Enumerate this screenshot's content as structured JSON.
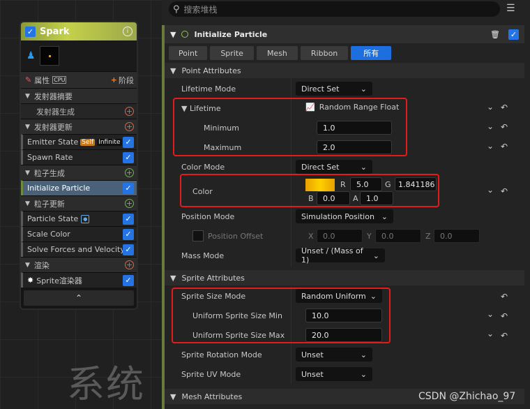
{
  "emitter": {
    "title": "Spark",
    "cpu_label": "属性",
    "cpu_badge": "CPU",
    "stage_button": "阶段",
    "rows": [
      {
        "label": "发射器摘要",
        "kind": "sec"
      },
      {
        "label": "发射器生成",
        "kind": "sub",
        "action": "add"
      },
      {
        "label": "发射器更新",
        "kind": "sec",
        "action": "add"
      },
      {
        "label": "Emitter State",
        "kind": "itm",
        "tag1": "Self",
        "tag2": "Infinite",
        "check": true
      },
      {
        "label": "Spawn Rate",
        "kind": "itm",
        "check": true
      },
      {
        "label": "粒子生成",
        "kind": "sec",
        "action": "add-green"
      },
      {
        "label": "Initialize Particle",
        "kind": "sel",
        "check": true
      },
      {
        "label": "粒子更新",
        "kind": "sec",
        "action": "add-green"
      },
      {
        "label": "Particle State",
        "kind": "itm",
        "dot": true,
        "check": true
      },
      {
        "label": "Scale Color",
        "kind": "itm",
        "check": true
      },
      {
        "label": "Solve Forces and Velocity",
        "kind": "itm",
        "check": true
      },
      {
        "label": "渲染",
        "kind": "sec",
        "action": "add"
      },
      {
        "label": "Sprite渲染器",
        "kind": "itm",
        "star": true,
        "check": true
      }
    ]
  },
  "watermark": "系统",
  "credit": "CSDN @Zhichao_97",
  "search": {
    "placeholder": "搜索堆栈"
  },
  "module": {
    "title": "Initialize Particle",
    "tabs": [
      "Point",
      "Sprite",
      "Mesh",
      "Ribbon",
      "所有"
    ],
    "active_tab": "所有"
  },
  "sections": {
    "point": "Point Attributes",
    "sprite": "Sprite Attributes",
    "mesh": "Mesh Attributes"
  },
  "props": {
    "lifetime_mode": {
      "label": "Lifetime Mode",
      "value": "Direct Set"
    },
    "lifetime": {
      "label": "Lifetime",
      "value": "Random Range Float"
    },
    "minimum": {
      "label": "Minimum",
      "value": "1.0"
    },
    "maximum": {
      "label": "Maximum",
      "value": "2.0"
    },
    "color_mode": {
      "label": "Color Mode",
      "value": "Direct Set"
    },
    "color": {
      "label": "Color",
      "r": "5.0",
      "g": "1.841186",
      "b": "0.0",
      "a": "1.0",
      "swatch": "#f2b800"
    },
    "position_mode": {
      "label": "Position Mode",
      "value": "Simulation Position"
    },
    "position_offset": {
      "label": "Position Offset",
      "x": "0.0",
      "y": "0.0",
      "z": "0.0"
    },
    "mass_mode": {
      "label": "Mass Mode",
      "value": "Unset / (Mass of 1)"
    },
    "sprite_size_mode": {
      "label": "Sprite Size Mode",
      "value": "Random Uniform"
    },
    "size_min": {
      "label": "Uniform Sprite Size Min",
      "value": "10.0"
    },
    "size_max": {
      "label": "Uniform Sprite Size Max",
      "value": "20.0"
    },
    "rotation_mode": {
      "label": "Sprite Rotation Mode",
      "value": "Unset"
    },
    "uv_mode": {
      "label": "Sprite UV Mode",
      "value": "Unset"
    }
  },
  "axis_letters": {
    "r": "R",
    "g": "G",
    "b": "B",
    "a": "A",
    "x": "X",
    "y": "Y",
    "z": "Z"
  }
}
